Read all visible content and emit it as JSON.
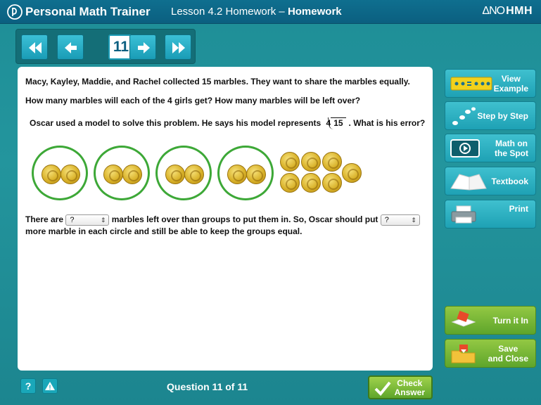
{
  "header": {
    "brand": "Personal Math Trainer",
    "lesson_prefix": "Lesson 4.2 Homework",
    "lesson_sep": " – ",
    "lesson_title": "Homework",
    "publisher_logo_glyphs": "ΔΝΟ",
    "publisher": "HMH"
  },
  "nav": {
    "current_question": "11"
  },
  "question": {
    "line1": "Macy, Kayley, Maddie, and Rachel collected 15 marbles. They want to share the marbles equally.",
    "line2": "How many marbles will each of the 4 girls get? How many marbles will be left over?",
    "line3_before": "Oscar used a model to solve this problem. He says his model represents",
    "divisor": "4",
    "dividend": "15",
    "line3_after": ". What is his error?",
    "answer_part1": "There are",
    "select1_value": "?",
    "answer_part2": "marbles left over than groups to put them in. So, Oscar should put",
    "select2_value": "?",
    "answer_part3": "more marble in each circle and still be able to keep the groups equal."
  },
  "model": {
    "groups": 4,
    "marbles_per_group": 2,
    "leftover_marbles": 7
  },
  "sidebar": {
    "view_example": "View Example",
    "view_example_l1": "View",
    "view_example_l2": "Example",
    "step_by_step": "Step by Step",
    "math_on_spot_l1": "Math on",
    "math_on_spot_l2": "the Spot",
    "textbook": "Textbook",
    "print": "Print",
    "turn_it_in": "Turn it In",
    "save_close_l1": "Save",
    "save_close_l2": "and Close"
  },
  "footer": {
    "help": "?",
    "alert": "!",
    "question_count": "Question 11 of 11",
    "check_l1": "Check",
    "check_l2": "Answer"
  },
  "colors": {
    "teal_bg": "#1e8e97",
    "header_bg": "#0b5f80",
    "circle_green": "#3da837",
    "button_teal": "#1ea1b4",
    "button_green": "#5ea52b"
  }
}
